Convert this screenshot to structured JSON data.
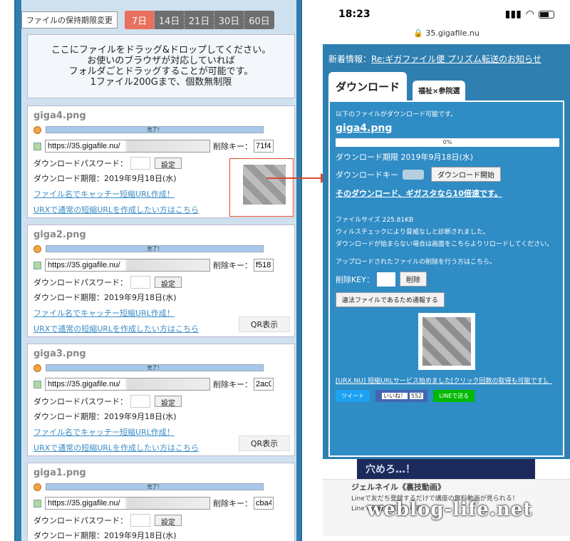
{
  "left": {
    "retention_button": "ファイルの保持期限変更",
    "periods": [
      "7日",
      "14日",
      "21日",
      "30日",
      "60日"
    ],
    "dropzone": [
      "ここにファイルをドラッグ&ドロップしてください。",
      "お使いのブラウザが対応していれば",
      "フォルダごとドラッグすることが可能です。",
      "1ファイル200Gまで、個数無制限"
    ],
    "files": [
      {
        "name": "giga4.png",
        "url": "https://35.gigafile.nu/",
        "del_key": "71f4",
        "qr": "thumb"
      },
      {
        "name": "giga2.png",
        "url": "https://35.gigafile.nu/",
        "del_key": "f518",
        "qr": "button"
      },
      {
        "name": "giga3.png",
        "url": "https://35.gigafile.nu/",
        "del_key": "2ac0",
        "qr": "button"
      },
      {
        "name": "giga1.png",
        "url": "https://35.gigafile.nu/",
        "del_key": "cba4",
        "qr": "none"
      }
    ],
    "labels": {
      "complete": "完了！",
      "delete_key": "削除キー：",
      "dl_password": "ダウンロードパスワード：",
      "set": "設定",
      "dl_limit": "ダウンロード期限：2019年9月18日(水)",
      "link1": "ファイル名でキャッチー短縮URL作成！",
      "link2": "URXで通常の短縮URLを作成したい方はこちら",
      "qr_button": "QR表示"
    }
  },
  "right": {
    "time": "18:23",
    "url": "35.gigafile.nu",
    "news_label": "新着情報：",
    "news_link": "Re:ギガファイル便 プリズム転送のお知らせ",
    "tab_download": "ダウンロード",
    "tab_other": "福祉×参院選",
    "available": "以下のファイルがダウンロード可能です。",
    "file_name": "giga4.png",
    "progress": "0%",
    "dl_limit": "ダウンロード期限 2019年9月18日(水)",
    "dl_key_label": "ダウンロードキー",
    "start_button": "ダウンロード開始",
    "gigasta": "そのダウンロード、ギガスタなら10倍速です。",
    "file_size": "ファイルサイズ 225.81KB",
    "virus": "ウィルスチェックにより脅威なしと診断されました。",
    "reload": "ダウンロードが始まらない場合は画面をこちらよりリロードしてください。",
    "delete_info": "アップロードされたファイルの削除を行う方はこちら。",
    "delete_key_label": "削除KEY：",
    "delete_button": "削除",
    "report_button": "違法ファイルであるため通報する",
    "urx": "[URX.NU] 短縮URLサービス始めました[クリック回数の取得も可能です]。",
    "tweet": "ツイート",
    "like": "いいね！",
    "like_count": "552",
    "line": "LINEで送る",
    "ad_banner": "穴めろ…！",
    "ad_title": "ジェルネイル《裏技動画》",
    "ad_text1": "Lineで友だち登録するだけで講座の無料動画が見られる！",
    "ad_text2": "Lineで気軽に質問も可能"
  },
  "watermark": "weblog-life.net"
}
